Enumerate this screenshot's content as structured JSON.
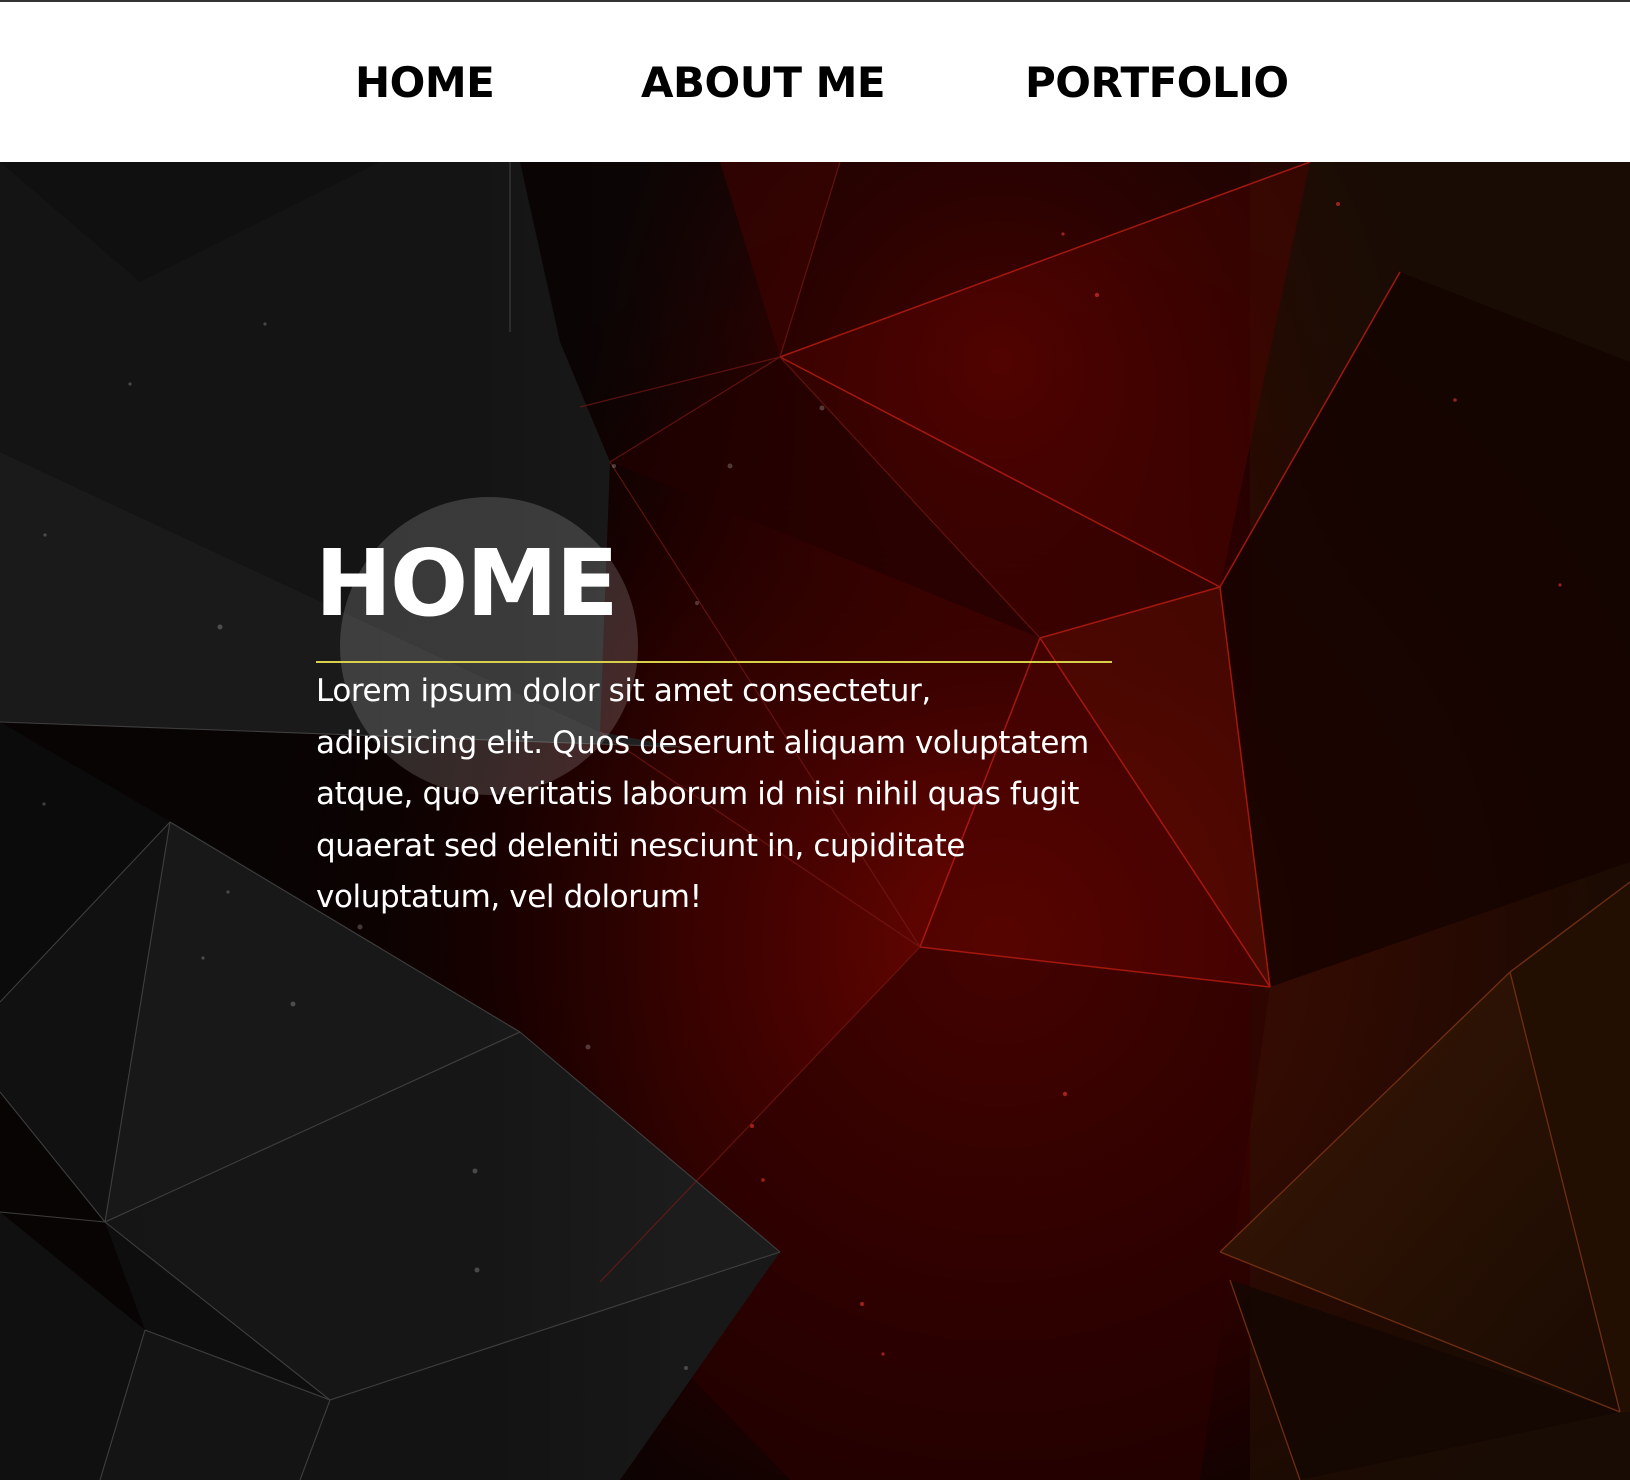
{
  "nav": {
    "items": [
      {
        "label": "HOME"
      },
      {
        "label": "ABOUT ME"
      },
      {
        "label": "PORTFOLIO"
      }
    ]
  },
  "hero": {
    "title": "HOME",
    "body": "Lorem ipsum dolor sit amet consectetur, adipisicing elit. Quos deserunt aliquam voluptatem atque, quo veritatis laborum id nisi nihil quas fugit quaerat sed deleniti nesciunt in, cupiditate voluptatum, vel dolorum!"
  },
  "colors": {
    "nav_background": "#ffffff",
    "nav_text": "#000000",
    "hero_text": "#ffffff",
    "divider": "#d8cf4a",
    "accent_red": "#8a0a00",
    "accent_amber": "#6a3a08"
  }
}
